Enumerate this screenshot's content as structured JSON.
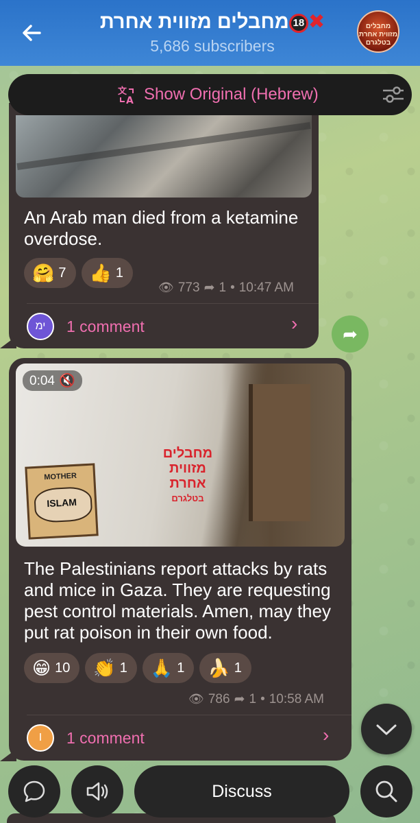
{
  "header": {
    "title": "מחבלים מזווית אחרת",
    "badge_18": "18",
    "subscribers": "5,686 subscribers",
    "avatar_text": "מחבלים מזווית אחרת בטלגרם"
  },
  "translate_bar": {
    "label": "Show Original (Hebrew)",
    "icon": "translate-icon"
  },
  "messages": [
    {
      "caption": "An Arab man died from a ketamine overdose.",
      "reactions": [
        {
          "emoji": "🤗",
          "count": "7"
        },
        {
          "emoji": "👍",
          "count": "1"
        }
      ],
      "views": "773",
      "forwards": "1",
      "time": "10:47 AM",
      "comment_avatar": "ימ",
      "comments": "1 comment"
    },
    {
      "duration": "0:04",
      "sticker_top": "MOTHER",
      "sticker_main": "ISLAM",
      "watermark_line1": "מחבלים",
      "watermark_line2": "מזווית אחרת",
      "watermark_line3": "בטלגרם",
      "caption": "The Palestinians report attacks by rats and mice in Gaza. They are requesting pest control materials. Amen, may they put rat poison in their own food.",
      "reactions": [
        {
          "emoji": "😁",
          "count": "10"
        },
        {
          "emoji": "👏",
          "count": "1"
        },
        {
          "emoji": "🙏",
          "count": "1"
        },
        {
          "emoji": "🍌",
          "count": "1"
        }
      ],
      "views": "786",
      "forwards": "1",
      "time": "10:58 AM",
      "comment_avatar": "I",
      "comments": "1 comment"
    }
  ],
  "bottom_bar": {
    "discuss_label": "Discuss"
  },
  "colors": {
    "header": "#2b73c9",
    "bubble": "#3a3232",
    "accent": "#f06fb0",
    "share": "#79b861"
  }
}
